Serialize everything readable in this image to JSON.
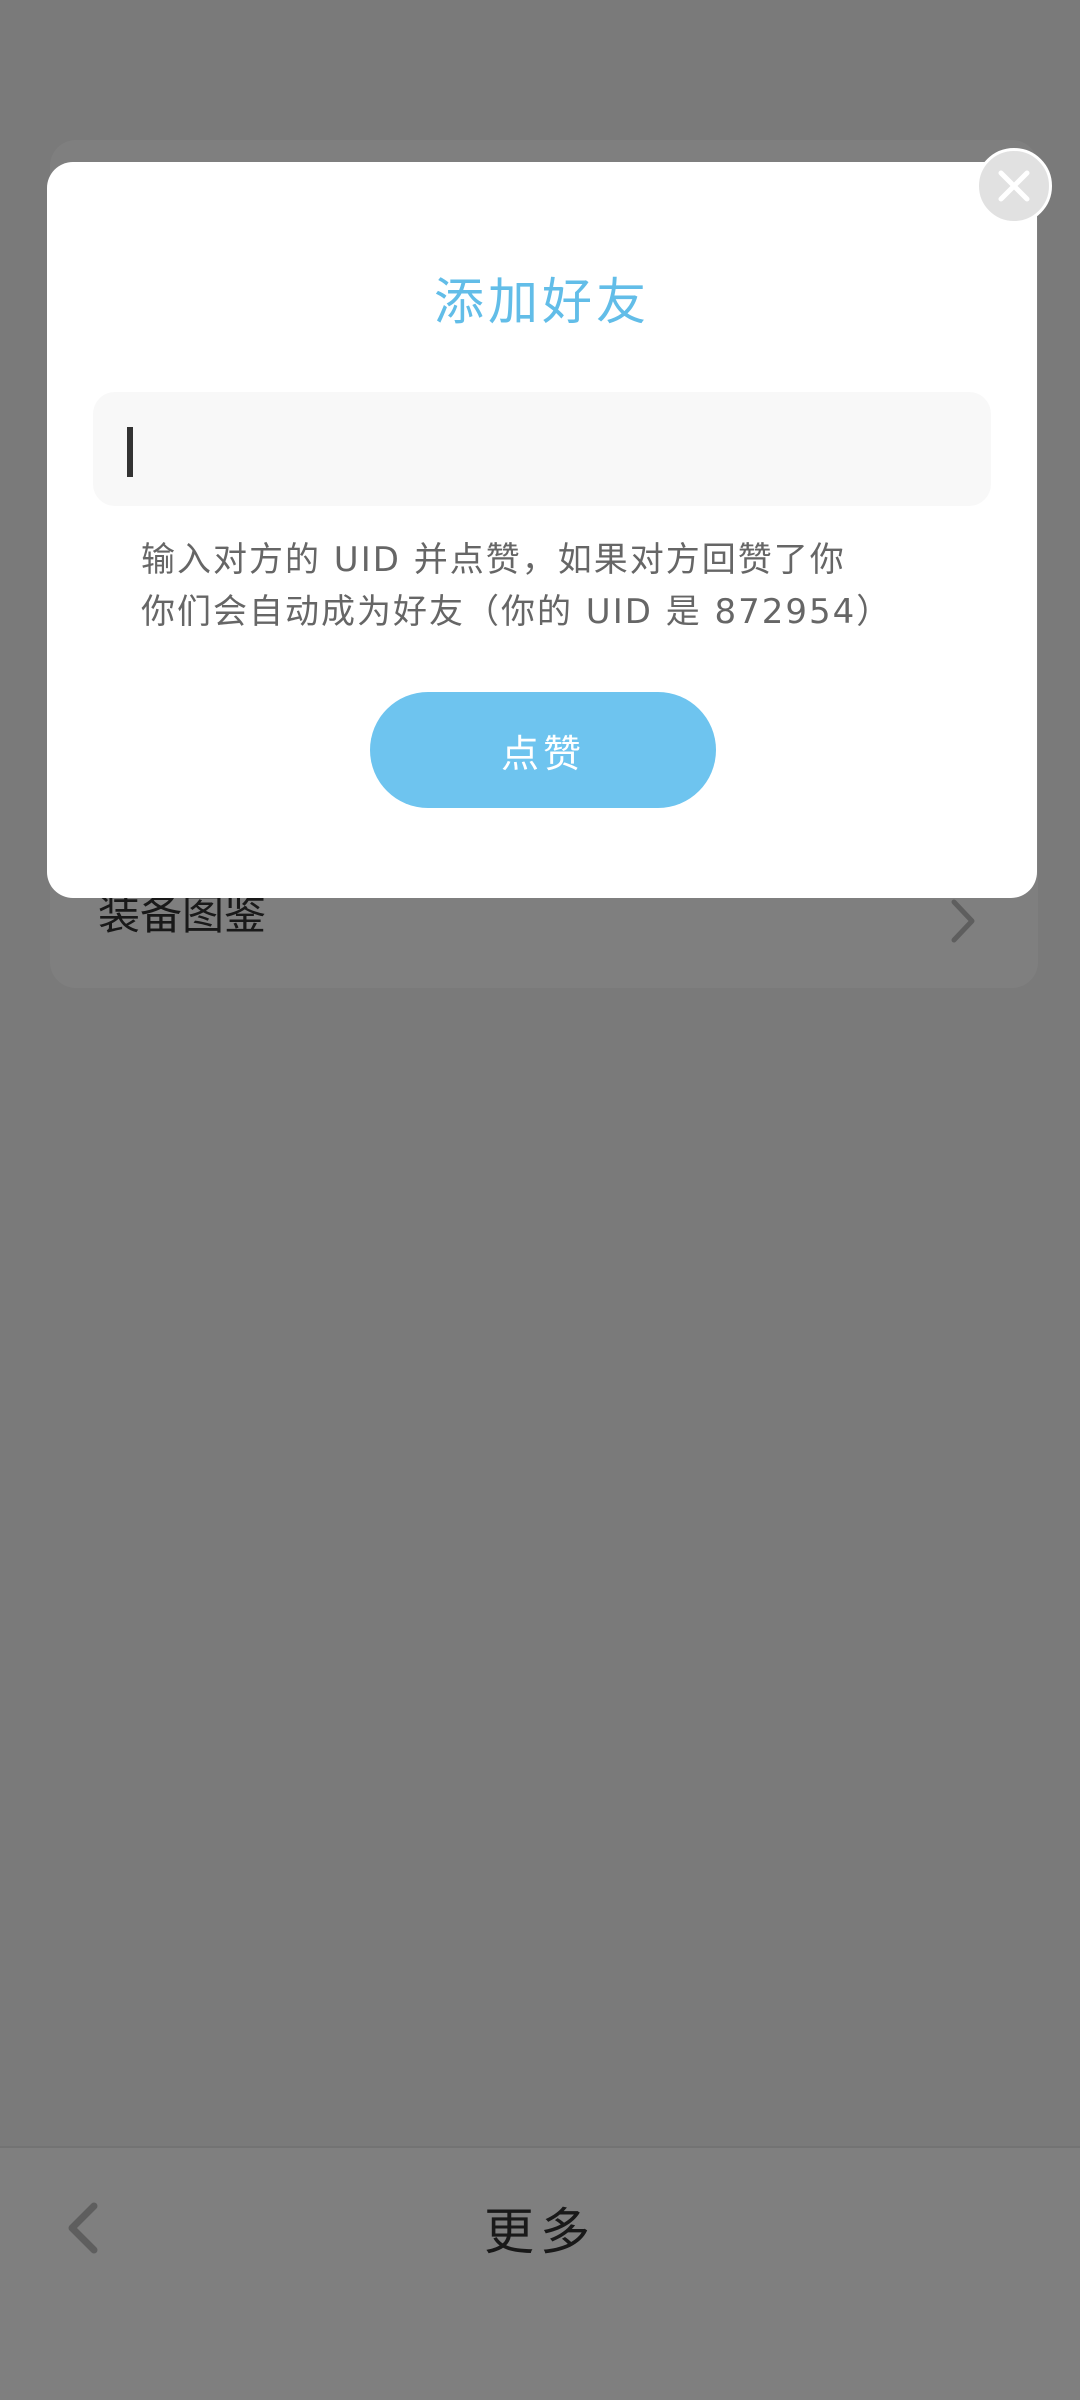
{
  "background": {
    "list_item_label": "装备图鉴",
    "bottom_title": "更多"
  },
  "modal": {
    "title": "添加好友",
    "input_value": "",
    "hint_line1": "输入对方的 UID 并点赞，如果对方回赞了你",
    "hint_line2": "你们会自动成为好友（你的 UID 是 872954）",
    "like_button_label": "点赞"
  },
  "icons": {
    "close": "close-icon",
    "back": "chevron-left-icon",
    "list_chevron": "chevron-right-icon"
  },
  "colors": {
    "accent": "#62bde8",
    "button": "#6ec4ef",
    "overlay": "rgba(0,0,0,0.5)"
  }
}
